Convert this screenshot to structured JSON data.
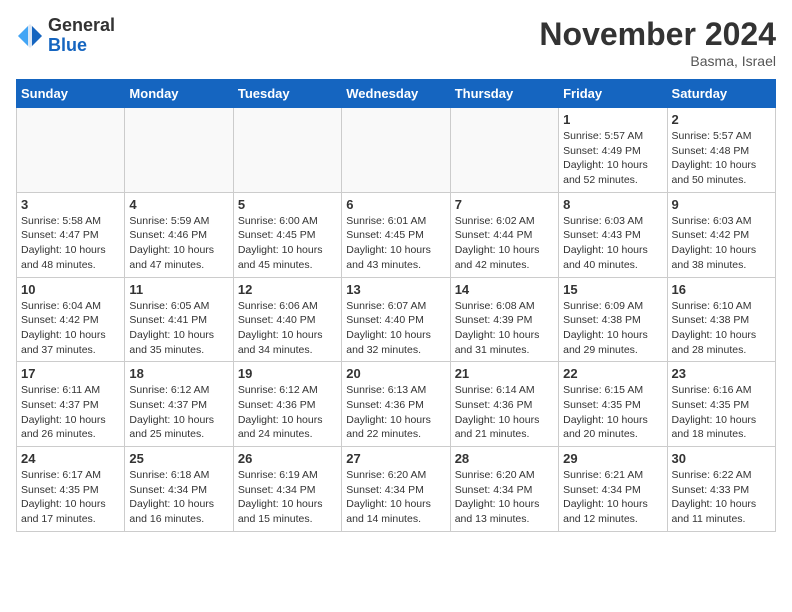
{
  "header": {
    "logo_general": "General",
    "logo_blue": "Blue",
    "month_title": "November 2024",
    "location": "Basma, Israel"
  },
  "days_of_week": [
    "Sunday",
    "Monday",
    "Tuesday",
    "Wednesday",
    "Thursday",
    "Friday",
    "Saturday"
  ],
  "weeks": [
    [
      {
        "day": "",
        "info": ""
      },
      {
        "day": "",
        "info": ""
      },
      {
        "day": "",
        "info": ""
      },
      {
        "day": "",
        "info": ""
      },
      {
        "day": "",
        "info": ""
      },
      {
        "day": "1",
        "info": "Sunrise: 5:57 AM\nSunset: 4:49 PM\nDaylight: 10 hours\nand 52 minutes."
      },
      {
        "day": "2",
        "info": "Sunrise: 5:57 AM\nSunset: 4:48 PM\nDaylight: 10 hours\nand 50 minutes."
      }
    ],
    [
      {
        "day": "3",
        "info": "Sunrise: 5:58 AM\nSunset: 4:47 PM\nDaylight: 10 hours\nand 48 minutes."
      },
      {
        "day": "4",
        "info": "Sunrise: 5:59 AM\nSunset: 4:46 PM\nDaylight: 10 hours\nand 47 minutes."
      },
      {
        "day": "5",
        "info": "Sunrise: 6:00 AM\nSunset: 4:45 PM\nDaylight: 10 hours\nand 45 minutes."
      },
      {
        "day": "6",
        "info": "Sunrise: 6:01 AM\nSunset: 4:45 PM\nDaylight: 10 hours\nand 43 minutes."
      },
      {
        "day": "7",
        "info": "Sunrise: 6:02 AM\nSunset: 4:44 PM\nDaylight: 10 hours\nand 42 minutes."
      },
      {
        "day": "8",
        "info": "Sunrise: 6:03 AM\nSunset: 4:43 PM\nDaylight: 10 hours\nand 40 minutes."
      },
      {
        "day": "9",
        "info": "Sunrise: 6:03 AM\nSunset: 4:42 PM\nDaylight: 10 hours\nand 38 minutes."
      }
    ],
    [
      {
        "day": "10",
        "info": "Sunrise: 6:04 AM\nSunset: 4:42 PM\nDaylight: 10 hours\nand 37 minutes."
      },
      {
        "day": "11",
        "info": "Sunrise: 6:05 AM\nSunset: 4:41 PM\nDaylight: 10 hours\nand 35 minutes."
      },
      {
        "day": "12",
        "info": "Sunrise: 6:06 AM\nSunset: 4:40 PM\nDaylight: 10 hours\nand 34 minutes."
      },
      {
        "day": "13",
        "info": "Sunrise: 6:07 AM\nSunset: 4:40 PM\nDaylight: 10 hours\nand 32 minutes."
      },
      {
        "day": "14",
        "info": "Sunrise: 6:08 AM\nSunset: 4:39 PM\nDaylight: 10 hours\nand 31 minutes."
      },
      {
        "day": "15",
        "info": "Sunrise: 6:09 AM\nSunset: 4:38 PM\nDaylight: 10 hours\nand 29 minutes."
      },
      {
        "day": "16",
        "info": "Sunrise: 6:10 AM\nSunset: 4:38 PM\nDaylight: 10 hours\nand 28 minutes."
      }
    ],
    [
      {
        "day": "17",
        "info": "Sunrise: 6:11 AM\nSunset: 4:37 PM\nDaylight: 10 hours\nand 26 minutes."
      },
      {
        "day": "18",
        "info": "Sunrise: 6:12 AM\nSunset: 4:37 PM\nDaylight: 10 hours\nand 25 minutes."
      },
      {
        "day": "19",
        "info": "Sunrise: 6:12 AM\nSunset: 4:36 PM\nDaylight: 10 hours\nand 24 minutes."
      },
      {
        "day": "20",
        "info": "Sunrise: 6:13 AM\nSunset: 4:36 PM\nDaylight: 10 hours\nand 22 minutes."
      },
      {
        "day": "21",
        "info": "Sunrise: 6:14 AM\nSunset: 4:36 PM\nDaylight: 10 hours\nand 21 minutes."
      },
      {
        "day": "22",
        "info": "Sunrise: 6:15 AM\nSunset: 4:35 PM\nDaylight: 10 hours\nand 20 minutes."
      },
      {
        "day": "23",
        "info": "Sunrise: 6:16 AM\nSunset: 4:35 PM\nDaylight: 10 hours\nand 18 minutes."
      }
    ],
    [
      {
        "day": "24",
        "info": "Sunrise: 6:17 AM\nSunset: 4:35 PM\nDaylight: 10 hours\nand 17 minutes."
      },
      {
        "day": "25",
        "info": "Sunrise: 6:18 AM\nSunset: 4:34 PM\nDaylight: 10 hours\nand 16 minutes."
      },
      {
        "day": "26",
        "info": "Sunrise: 6:19 AM\nSunset: 4:34 PM\nDaylight: 10 hours\nand 15 minutes."
      },
      {
        "day": "27",
        "info": "Sunrise: 6:20 AM\nSunset: 4:34 PM\nDaylight: 10 hours\nand 14 minutes."
      },
      {
        "day": "28",
        "info": "Sunrise: 6:20 AM\nSunset: 4:34 PM\nDaylight: 10 hours\nand 13 minutes."
      },
      {
        "day": "29",
        "info": "Sunrise: 6:21 AM\nSunset: 4:34 PM\nDaylight: 10 hours\nand 12 minutes."
      },
      {
        "day": "30",
        "info": "Sunrise: 6:22 AM\nSunset: 4:33 PM\nDaylight: 10 hours\nand 11 minutes."
      }
    ]
  ]
}
